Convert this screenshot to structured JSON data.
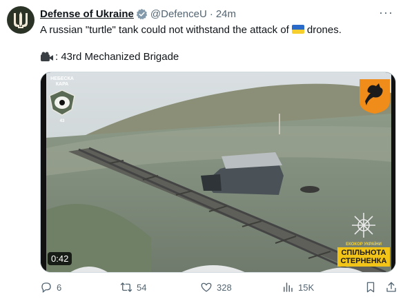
{
  "tweet": {
    "display_name": "Defense of Ukraine",
    "handle": "@DefenceU",
    "separator": "·",
    "time": "24m",
    "more_label": "···",
    "text_before_flag": "A russian \"turtle\" tank could not withstand the attack of",
    "text_after_flag": "drones.",
    "credit_text": ": 43rd Mechanized Brigade"
  },
  "media": {
    "duration": "0:42",
    "badge_left_line1": "НЕБЕСКА КАРА",
    "badge_left_line2": "43",
    "watermark_small": "ЕКОКОР УКРАЇНИ",
    "watermark_line1": "СПІЛЬНОТА",
    "watermark_line2": "СТЕРНЕНКА"
  },
  "actions": {
    "replies": "6",
    "reposts": "54",
    "likes": "328",
    "views": "15K"
  },
  "colors": {
    "text": "#0f1419",
    "secondary": "#536471",
    "verified": "#829aab",
    "flag_blue": "#2a6ac8",
    "flag_yellow": "#f6cf2e"
  },
  "icons": [
    "trident-icon",
    "verified-badge-icon",
    "more-icon",
    "ukraine-flag-icon",
    "camera-icon",
    "reply-icon",
    "retweet-icon",
    "like-icon",
    "views-icon",
    "bookmark-icon",
    "share-icon"
  ]
}
